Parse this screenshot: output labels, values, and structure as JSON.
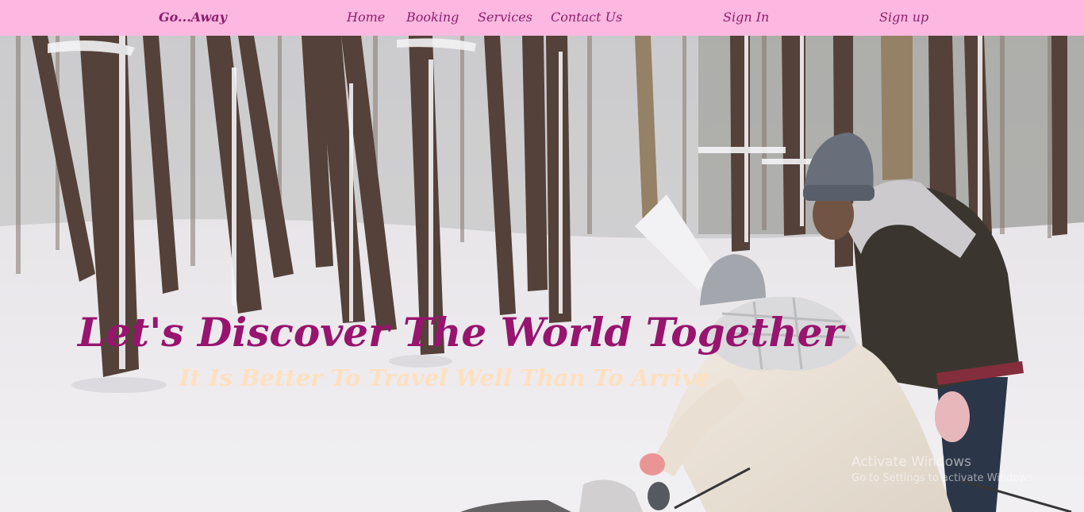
{
  "nav": {
    "brand": "Go...Away",
    "links": [
      "Home",
      "Booking",
      "Services",
      "Contact Us"
    ],
    "sign_in": "Sign In",
    "sign_up": "Sign up"
  },
  "hero": {
    "title": "Let's Discover The World Together",
    "subtitle": "It Is Better To Travel Well Than To Arrive"
  },
  "watermark": {
    "title": "Activate Windows",
    "subtitle": "Go to Settings to activate Windows."
  },
  "colors": {
    "nav_background": "#fcb8e0",
    "nav_text": "#8a1e6c",
    "title": "#97146f",
    "subtitle": "#ffe0bf"
  }
}
